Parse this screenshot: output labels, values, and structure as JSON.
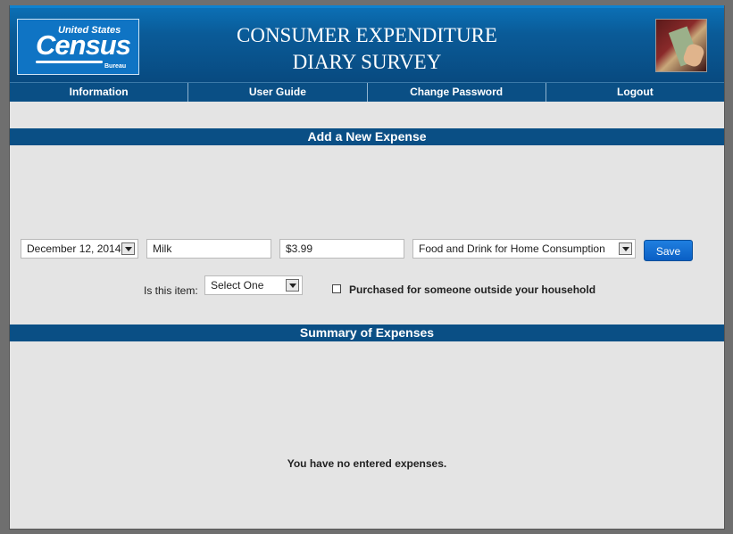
{
  "header": {
    "logo": {
      "line1": "United States",
      "line2": "Census",
      "line3": "Bureau"
    },
    "title_line1": "CONSUMER EXPENDITURE",
    "title_line2": "DIARY SURVEY"
  },
  "nav": {
    "items": [
      {
        "label": "Information"
      },
      {
        "label": "User Guide"
      },
      {
        "label": "Change Password"
      },
      {
        "label": "Logout"
      }
    ]
  },
  "add_expense": {
    "heading": "Add a New Expense",
    "date": "December 12, 2014",
    "item": "Milk",
    "amount": "$3.99",
    "category": "Food and Drink for Home Consumption",
    "save_label": "Save",
    "item_type_label": "Is this item:",
    "item_type_value": "Select One",
    "purchased_outside_label": "Purchased for someone outside your household"
  },
  "summary": {
    "heading": "Summary of Expenses",
    "empty_message": "You have no entered expenses."
  },
  "colors": {
    "nav_bar": "#0a4f85",
    "header_top": "#0b6fb5",
    "page_bg": "#e4e4e4",
    "save_button": "#0a5fc4"
  }
}
